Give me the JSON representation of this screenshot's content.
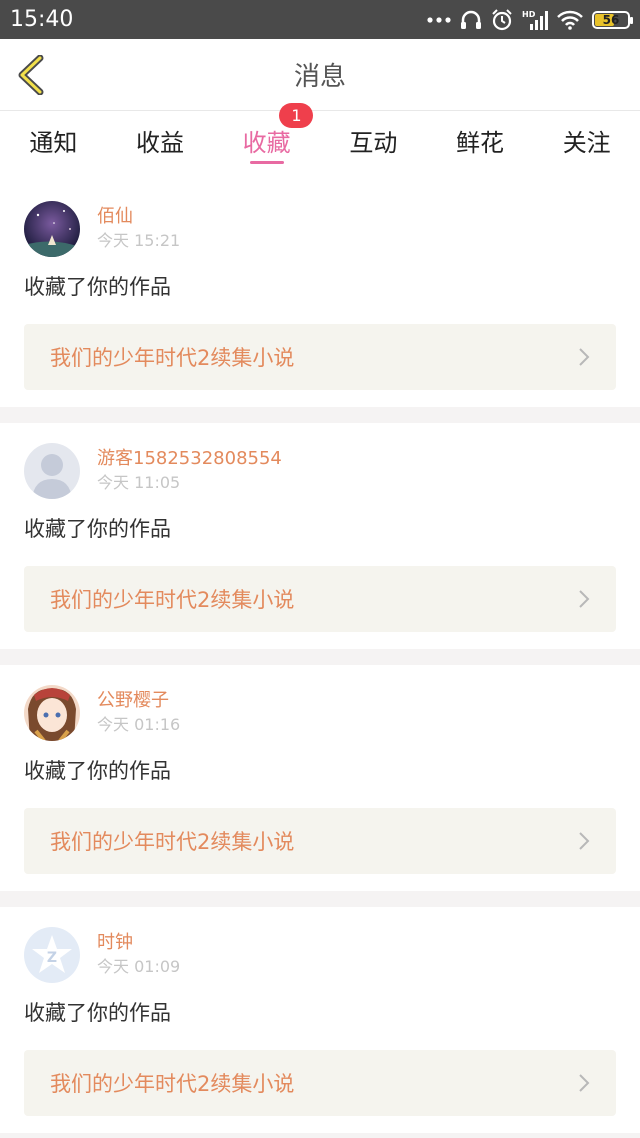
{
  "status_bar": {
    "time": "15:40",
    "battery": "56",
    "network": "HD"
  },
  "header": {
    "title": "消息"
  },
  "tabs": [
    {
      "label": "通知"
    },
    {
      "label": "收益"
    },
    {
      "label": "收藏",
      "badge": "1",
      "active": true
    },
    {
      "label": "互动"
    },
    {
      "label": "鲜花"
    },
    {
      "label": "关注"
    }
  ],
  "messages": [
    {
      "name": "佰仙",
      "time": "今天 15:21",
      "action": "收藏了你的作品",
      "work": "我们的少年时代2续集小说",
      "avatar": "avatar-night"
    },
    {
      "name": "游客1582532808554",
      "time": "今天 11:05",
      "action": "收藏了你的作品",
      "work": "我们的少年时代2续集小说",
      "avatar": "avatar-default"
    },
    {
      "name": "公野樱子",
      "time": "今天 01:16",
      "action": "收藏了你的作品",
      "work": "我们的少年时代2续集小说",
      "avatar": "avatar-anime"
    },
    {
      "name": "时钟",
      "time": "今天 01:09",
      "action": "收藏了你的作品",
      "work": "我们的少年时代2续集小说",
      "avatar": "avatar-qzone"
    }
  ],
  "colors": {
    "accent": "#e86aa2",
    "name": "#e38a5d",
    "badge": "#ef3f4c"
  }
}
